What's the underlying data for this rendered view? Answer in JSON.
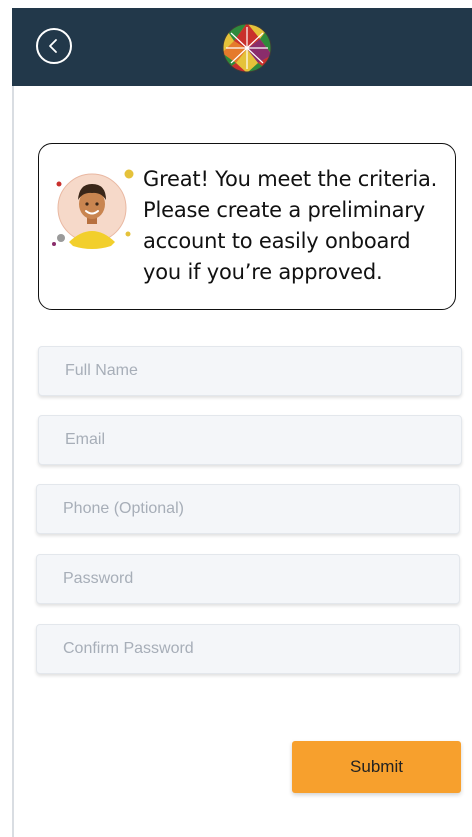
{
  "header": {
    "back_icon": "chevron-left-icon",
    "logo_icon": "globe-logo-icon",
    "background": "#22384a"
  },
  "message_card": {
    "avatar_icon": "person-avatar-icon",
    "text": "Great! You meet the criteria. Please create a preliminary account to easily onboard you if you’re approved."
  },
  "form": {
    "full_name": {
      "placeholder": "Full Name",
      "value": ""
    },
    "email": {
      "placeholder": "Email",
      "value": ""
    },
    "phone": {
      "placeholder": "Phone (Optional)",
      "value": ""
    },
    "password": {
      "placeholder": "Password",
      "value": ""
    },
    "confirm_password": {
      "placeholder": "Confirm Password",
      "value": ""
    },
    "submit_label": "Submit",
    "submit_color": "#f7a02d"
  }
}
